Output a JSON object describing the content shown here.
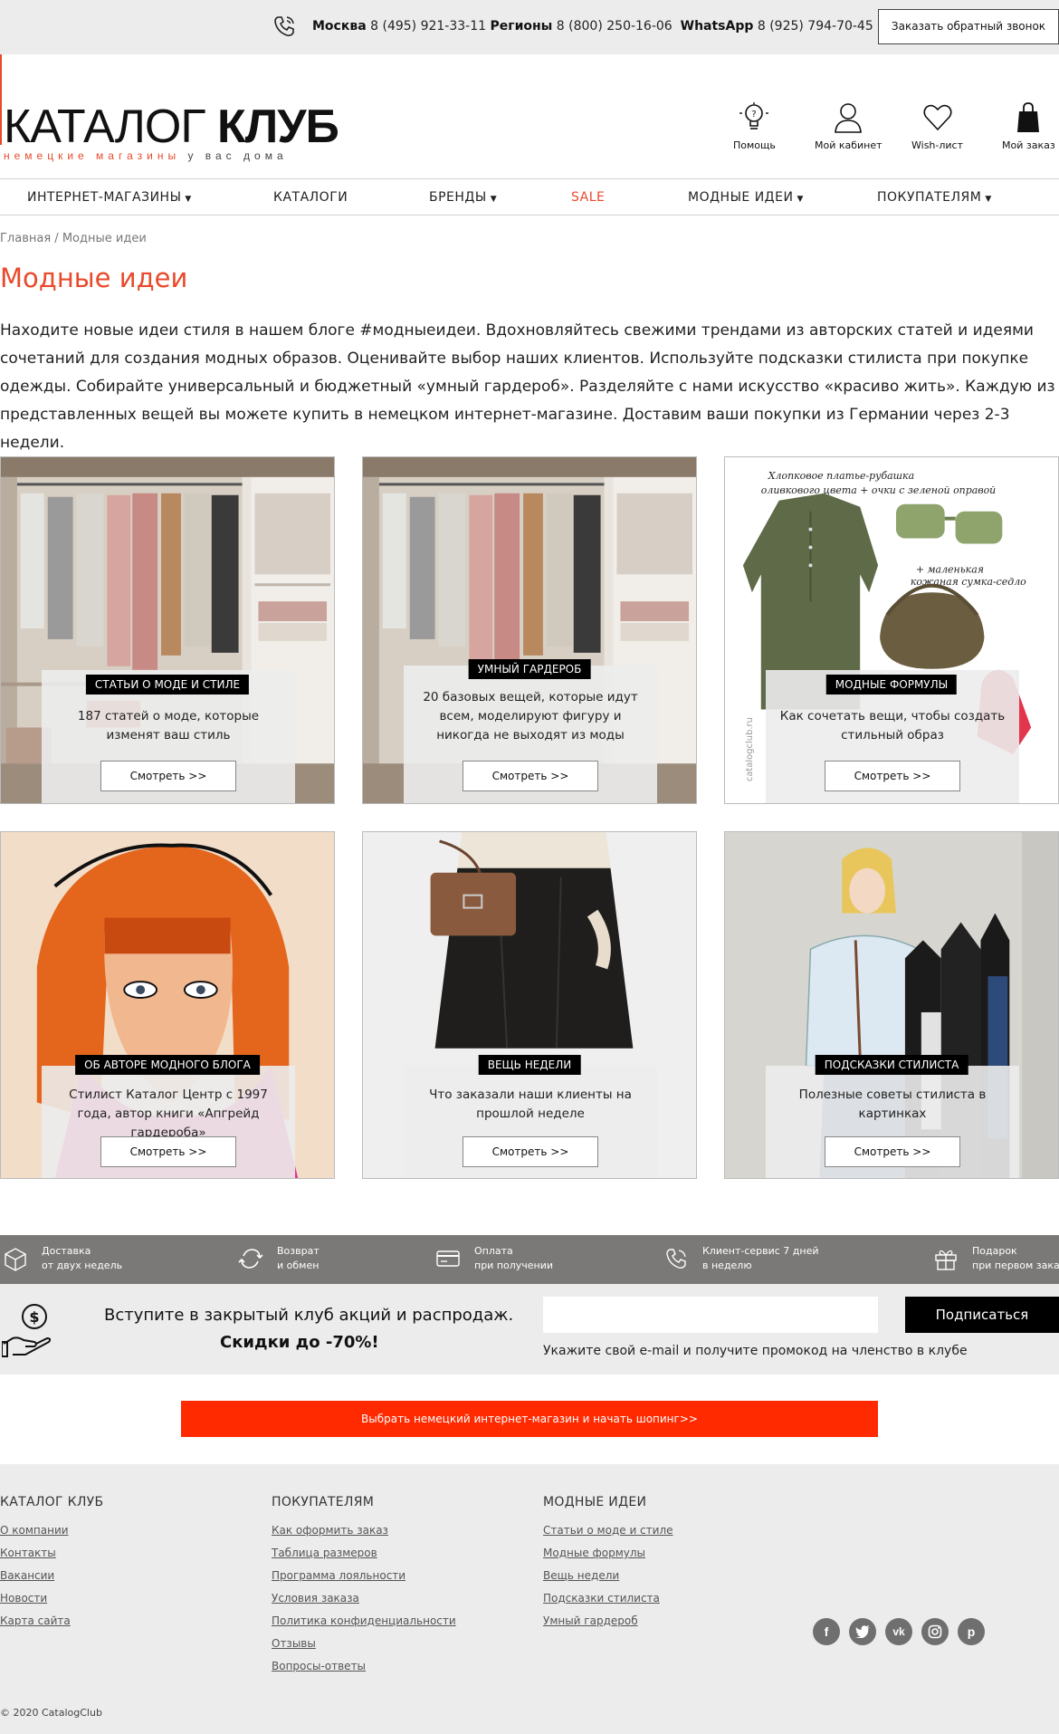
{
  "topbar": {
    "phones": [
      {
        "label": "Москва",
        "number": "8 (495) 921-33-11"
      },
      {
        "label": "Регионы",
        "number": "8 (800) 250-16-06"
      },
      {
        "label": "WhatsApp",
        "number": "8 (925) 794-70-45"
      }
    ],
    "callback": "Заказать обратный звонок"
  },
  "logo": {
    "word1": "КАТАЛОГ",
    "word2": "КЛУБ",
    "sub1": "немецкие магазины",
    "sub2": "у вас дома"
  },
  "header_icons": [
    {
      "name": "help",
      "label": "Помощь"
    },
    {
      "name": "account",
      "label": "Мой кабинет"
    },
    {
      "name": "wishlist",
      "label": "Wish-лист"
    },
    {
      "name": "cart",
      "label": "Мой заказ"
    }
  ],
  "nav": [
    {
      "label": "ИНТЕРНЕТ-МАГАЗИНЫ",
      "caret": "▼"
    },
    {
      "label": "КАТАЛОГИ",
      "caret": ""
    },
    {
      "label": "БРЕНДЫ",
      "caret": "▼"
    },
    {
      "label": "SALE",
      "caret": ""
    },
    {
      "label": "МОДНЫЕ ИДЕИ",
      "caret": "▼"
    },
    {
      "label": "ПОКУПАТЕЛЯМ",
      "caret": "▼"
    }
  ],
  "breadcrumb": {
    "home": "Главная",
    "sep": "/",
    "current": "Модные идеи"
  },
  "page_title": "Модные идеи",
  "intro": "Находите новые идеи стиля в нашем блоге #модныеидеи. Вдохновляйтесь свежими трендами из авторских статей и идеями сочетаний для создания модных образов. Оценивайте выбор наших клиентов. Используйте подсказки стилиста при покупке одежды. Собирайте универсальный и бюджетный «умный гардероб». Разделяйте с нами искусство «красиво жить». Каждую из представленных вещей вы можете купить в немецком интернет-магазине. Доставим ваши покупки из Германии через 2-3 недели.",
  "cards": [
    {
      "tag": "СТАТЬИ О МОДЕ И СТИЛЕ",
      "desc": "187 статей о моде, которые изменят ваш стиль",
      "button": "Смотреть >>"
    },
    {
      "tag": "УМНЫЙ ГАРДЕРОБ",
      "desc": "20 базовых вещей, которые идут всем, моделируют фигуру и никогда не выходят из моды",
      "button": "Смотреть >>"
    },
    {
      "tag": "МОДНЫЕ ФОРМУЛЫ",
      "desc": "Как сочетать вещи, чтобы создать стильный образ",
      "button": "Смотреть >>",
      "art_text": {
        "line1": "Хлопковое платье-рубашка",
        "line2": "оливкового цвета + очки с зеленой оправой",
        "line3": "+ маленькая",
        "line4": "кожаная сумка-седло",
        "watermark": "catalogclub.ru"
      }
    },
    {
      "tag": "ОБ АВТОРЕ МОДНОГО БЛОГА",
      "desc": "Стилист Каталог Центр с 1997 года, автор книги «Апгрейд гардероба»",
      "button": "Смотреть >>"
    },
    {
      "tag": "ВЕЩЬ НЕДЕЛИ",
      "desc": "Что заказали наши клиенты на прошлой неделе",
      "button": "Смотреть >>"
    },
    {
      "tag": "ПОДСКАЗКИ СТИЛИСТА",
      "desc": "Полезные советы стилиста в картинках",
      "button": "Смотреть >>"
    }
  ],
  "features": [
    {
      "icon": "box-icon",
      "line1": "Доставка",
      "line2": "от двух недель"
    },
    {
      "icon": "return-icon",
      "line1": "Возврат",
      "line2": "и обмен"
    },
    {
      "icon": "card-icon",
      "line1": "Оплата",
      "line2": "при получении"
    },
    {
      "icon": "phone-icon",
      "line1": "Клиент-сервис 7 дней",
      "line2": "в неделю"
    },
    {
      "icon": "gift-icon",
      "line1": "Подарок",
      "line2": "при первом заказе"
    }
  ],
  "subscribe": {
    "title": "Вступите в закрытый клуб акций и распродаж.",
    "title2": "Скидки до -70%!",
    "input_value": "",
    "button": "Подписаться",
    "hint": "Укажите свой e-mail и получите промокод на членство в клубе"
  },
  "cta": "Выбрать немецкий интернет-магазин и начать шопинг>>",
  "footer": {
    "cols": [
      {
        "title": "КАТАЛОГ КЛУБ",
        "links": [
          "О компании",
          "Контакты",
          "Вакансии",
          "Новости",
          "Карта сайта"
        ]
      },
      {
        "title": "ПОКУПАТЕЛЯМ",
        "links": [
          "Как оформить заказ",
          "Таблица размеров",
          "Программа лояльности",
          "Условия заказа",
          "Политика конфиденциальности",
          "Отзывы",
          "Вопросы-ответы"
        ]
      },
      {
        "title": "МОДНЫЕ ИДЕИ",
        "links": [
          "Статьи о моде и стиле",
          "Модные формулы",
          "Вещь недели",
          "Подсказки стилиста",
          "Умный гардероб"
        ]
      }
    ],
    "socials": [
      "facebook-icon",
      "twitter-icon",
      "vk-icon",
      "instagram-icon",
      "pinterest-icon"
    ],
    "copyright": "© 2020 CatalogClub"
  },
  "colors": {
    "accent": "#e84a2b",
    "cta": "#ff2a00",
    "features_bg": "#7a7978",
    "light_bg": "#ececec"
  }
}
